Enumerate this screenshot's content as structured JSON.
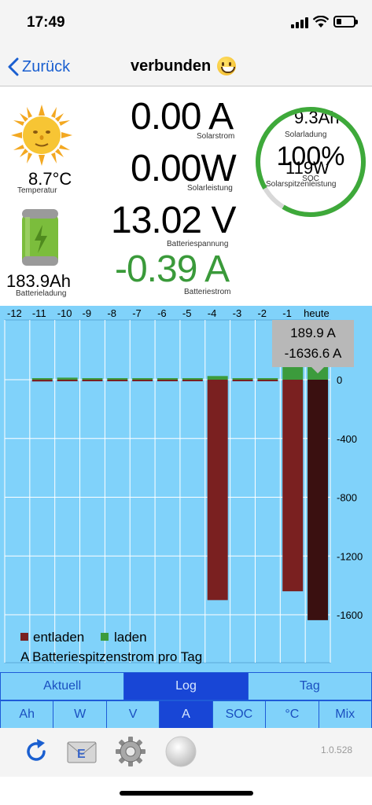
{
  "status_bar": {
    "time": "17:49"
  },
  "nav": {
    "back_label": "Zurück",
    "title": "verbunden"
  },
  "metrics": {
    "temperature": {
      "value": "8.7°C",
      "caption": "Temperatur"
    },
    "battery_charge": {
      "value": "183.9Ah",
      "caption": "Batterieladung"
    },
    "solar_current": {
      "value": "0.00 A",
      "caption": "Solarstrom"
    },
    "solar_power": {
      "value": "0.00W",
      "caption": "Solarleistung"
    },
    "battery_voltage": {
      "value": "13.02 V",
      "caption": "Batteriespannung"
    },
    "battery_current": {
      "value": "-0.39 A",
      "caption": "Batteriestrom"
    },
    "solar_charge": {
      "value": "9.3Ah",
      "caption": "Solarladung"
    },
    "solar_peak_power": {
      "value": "119W",
      "caption": "Solarspitzenleistung"
    },
    "soc": {
      "value": "100%",
      "caption": "SOC",
      "fraction": 1.0
    }
  },
  "chart_data": {
    "type": "bar",
    "categories": [
      "-12",
      "-11",
      "-10",
      "-9",
      "-8",
      "-7",
      "-6",
      "-5",
      "-4",
      "-3",
      "-2",
      "-1",
      "heute"
    ],
    "series": [
      {
        "name": "entladen",
        "values": [
          0,
          -12,
          -8,
          -4,
          -2,
          -2,
          -1,
          -3,
          -1500,
          -8,
          -6,
          -1440,
          -1636.6
        ]
      },
      {
        "name": "laden",
        "values": [
          0,
          4,
          14,
          6,
          3,
          3,
          2,
          10,
          25,
          6,
          8,
          150,
          189.9
        ]
      }
    ],
    "ylim": [
      -1680,
      0
    ],
    "yticks": [
      0,
      -400,
      -800,
      -1200,
      -1600
    ],
    "legend_position": "bottom-left",
    "ylabel": "A Batteriespitzenstrom pro Tag",
    "tooltip": {
      "line1": "189.9 A",
      "line2": "-1636.6 A"
    },
    "colors": {
      "entladen": "#7a2020",
      "laden": "#3c9b3c",
      "selected_entladen": "#3a1010",
      "background": "#80d2fa",
      "tooltip_bg": "#b8b8b8"
    }
  },
  "segments_top": [
    {
      "label": "Aktuell",
      "active": false
    },
    {
      "label": "Log",
      "active": true
    },
    {
      "label": "Tag",
      "active": false
    }
  ],
  "segments_bottom": [
    {
      "label": "Ah",
      "active": false
    },
    {
      "label": "W",
      "active": false
    },
    {
      "label": "V",
      "active": false
    },
    {
      "label": "A",
      "active": true
    },
    {
      "label": "SOC",
      "active": false
    },
    {
      "label": "°C",
      "active": false
    },
    {
      "label": "Mix",
      "active": false
    }
  ],
  "toolbar": {
    "icons": [
      "refresh-icon",
      "email-icon",
      "settings-icon",
      "record-button-icon"
    ],
    "email_letter": "E",
    "version": "1.0.528"
  }
}
